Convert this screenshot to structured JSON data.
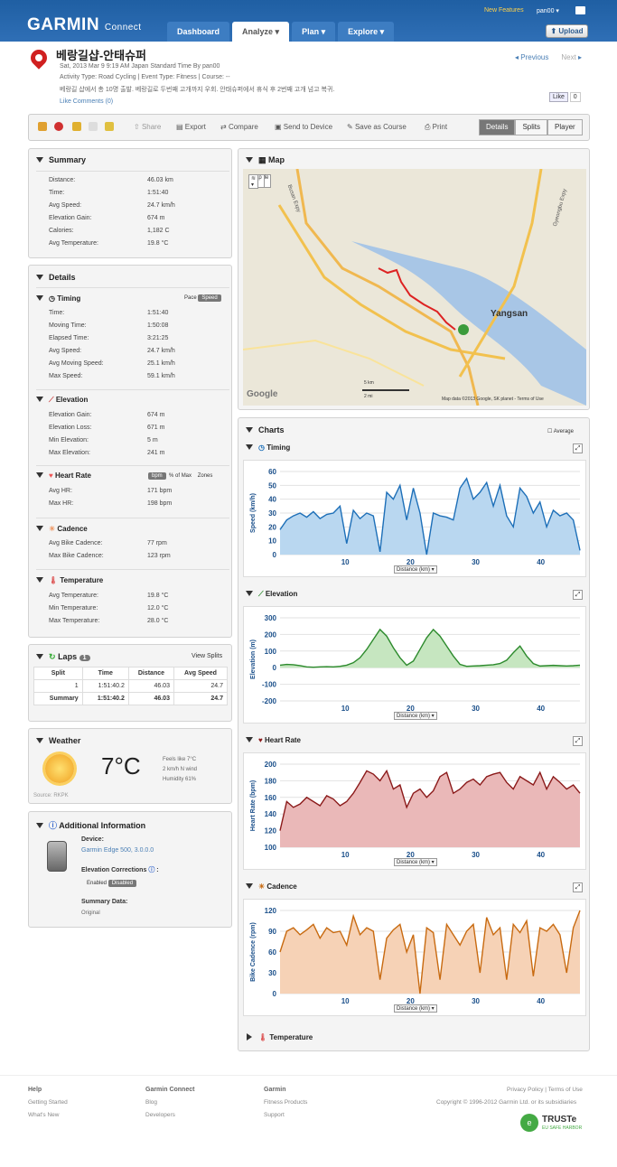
{
  "header": {
    "logo": "GARMIN",
    "logo_sub": "Connect",
    "new_features": "New Features",
    "user": "pan00 ▾",
    "upload": "Upload",
    "nav": [
      "Dashboard",
      "Analyze ▾",
      "Plan ▾",
      "Explore ▾"
    ]
  },
  "activity": {
    "title": "베랑길샵-안태슈퍼",
    "date_line": "Sat, 2013 Mar 9 9:19 AM Japan Standard Time By pan00",
    "type_line": "Activity Type: Road Cycling | Event Type: Fitness | Course: --",
    "desc": "베랑길 샵에서 총 10명 출발. 베랑길로 두번째 고개까지 우회. 안태슈퍼에서 휴식 후 2번째 고개 넘고 복귀.",
    "links": "Like   Comments (0)",
    "prev": "Previous",
    "next": "Next",
    "fb_like": "Like",
    "fb_count": "0"
  },
  "toolbar": {
    "share": "Share",
    "export": "Export",
    "compare": "Compare",
    "send": "Send to Device",
    "save": "Save as Course",
    "print": "Print",
    "tabs": [
      "Details",
      "Splits",
      "Player"
    ]
  },
  "summary": {
    "title": "Summary",
    "rows": [
      [
        "Distance:",
        "46.03 km"
      ],
      [
        "Time:",
        "1:51:40"
      ],
      [
        "Avg Speed:",
        "24.7 km/h"
      ],
      [
        "Elevation Gain:",
        "674 m"
      ],
      [
        "Calories:",
        "1,182 C"
      ],
      [
        "Avg Temperature:",
        "19.8 °C"
      ]
    ]
  },
  "details": {
    "title": "Details",
    "timing": {
      "title": "Timing",
      "pace": "Pace",
      "speed": "Speed",
      "rows": [
        [
          "Time:",
          "1:51:40"
        ],
        [
          "Moving Time:",
          "1:50:08"
        ],
        [
          "Elapsed Time:",
          "3:21:25"
        ],
        [
          "Avg Speed:",
          "24.7 km/h"
        ],
        [
          "Avg Moving Speed:",
          "25.1 km/h"
        ],
        [
          "Max Speed:",
          "59.1 km/h"
        ]
      ]
    },
    "elevation": {
      "title": "Elevation",
      "rows": [
        [
          "Elevation Gain:",
          "674 m"
        ],
        [
          "Elevation Loss:",
          "671 m"
        ],
        [
          "Min Elevation:",
          "5 m"
        ],
        [
          "Max Elevation:",
          "241 m"
        ]
      ]
    },
    "hr": {
      "title": "Heart Rate",
      "bpm": "bpm",
      "pct": "% of Max",
      "zones": "Zones",
      "rows": [
        [
          "Avg HR:",
          "171 bpm"
        ],
        [
          "Max HR:",
          "198 bpm"
        ]
      ]
    },
    "cadence": {
      "title": "Cadence",
      "rows": [
        [
          "Avg Bike Cadence:",
          "77 rpm"
        ],
        [
          "Max Bike Cadence:",
          "123 rpm"
        ]
      ]
    },
    "temp": {
      "title": "Temperature",
      "rows": [
        [
          "Avg Temperature:",
          "19.8 °C"
        ],
        [
          "Min Temperature:",
          "12.0 °C"
        ],
        [
          "Max Temperature:",
          "28.0 °C"
        ]
      ]
    }
  },
  "laps": {
    "title": "Laps",
    "count": "1",
    "view": "View Splits",
    "cols": [
      "Split",
      "Time",
      "Distance",
      "Avg Speed"
    ],
    "rows": [
      [
        "1",
        "1:51:40.2",
        "46.03",
        "24.7"
      ],
      [
        "Summary",
        "1:51:40.2",
        "46.03",
        "24.7"
      ]
    ]
  },
  "weather": {
    "title": "Weather",
    "temp": "7°C",
    "feels": "Feels like 7°C",
    "wind": "2 km/h N wind",
    "humidity": "Humidity 61%",
    "source": "Source: RKPK"
  },
  "additional": {
    "title": "Additional Information",
    "device_label": "Device:",
    "device": "Garmin Edge 500, 3.0.0.0",
    "elev_corr": "Elevation Corrections",
    "enabled": "Enabled",
    "disabled": "Disabled",
    "summary_label": "Summary Data:",
    "summary_val": "Original"
  },
  "map": {
    "title": "Map",
    "google": "Google ▾",
    "maptype": "Map ▾",
    "city": "Yangsan",
    "scale_km": "5 km",
    "scale_mi": "2 mi",
    "credit": "Map data ©2013 Google, SK planet - Terms of Use",
    "road1": "Gyeongbu Expy",
    "road2": "Busan Expy"
  },
  "charts_title": "Charts",
  "average": "Average",
  "dist_label": "Distance (km)",
  "temperature_title": "Temperature",
  "chart_data": [
    {
      "type": "area",
      "title": "Timing",
      "ylabel": "Speed (km/h)",
      "xlabel": "Distance (km)",
      "x_ticks": [
        10,
        20,
        30,
        40
      ],
      "y_ticks": [
        0,
        10,
        20,
        30,
        40,
        50,
        60
      ],
      "ylim": [
        0,
        60
      ],
      "xlim": [
        0,
        46
      ],
      "series": [
        {
          "values": [
            18,
            25,
            28,
            30,
            27,
            31,
            26,
            29,
            30,
            35,
            8,
            32,
            26,
            30,
            28,
            2,
            45,
            40,
            50,
            25,
            48,
            30,
            0,
            30,
            28,
            27,
            25,
            48,
            55,
            40,
            45,
            52,
            35,
            50,
            28,
            20,
            48,
            42,
            30,
            38,
            20,
            32,
            28,
            30,
            25,
            3
          ]
        }
      ]
    },
    {
      "type": "area",
      "title": "Elevation",
      "ylabel": "Elevation (m)",
      "xlabel": "Distance (km)",
      "x_ticks": [
        10,
        20,
        30,
        40
      ],
      "y_ticks": [
        -200,
        -100,
        0,
        100,
        200,
        300
      ],
      "ylim": [
        -200,
        300
      ],
      "xlim": [
        0,
        46
      ],
      "series": [
        {
          "values": [
            15,
            20,
            18,
            12,
            5,
            3,
            5,
            6,
            5,
            8,
            15,
            30,
            60,
            110,
            170,
            230,
            190,
            120,
            60,
            15,
            40,
            110,
            180,
            230,
            190,
            130,
            70,
            20,
            8,
            10,
            12,
            15,
            18,
            25,
            45,
            90,
            130,
            70,
            25,
            10,
            12,
            14,
            12,
            10,
            12,
            15
          ]
        }
      ]
    },
    {
      "type": "area",
      "title": "Heart Rate",
      "ylabel": "Heart Rate (bpm)",
      "xlabel": "Distance (km)",
      "x_ticks": [
        10,
        20,
        30,
        40
      ],
      "y_ticks": [
        100,
        120,
        140,
        160,
        180,
        200
      ],
      "ylim": [
        100,
        200
      ],
      "xlim": [
        0,
        46
      ],
      "series": [
        {
          "values": [
            120,
            155,
            148,
            152,
            160,
            155,
            150,
            162,
            158,
            150,
            155,
            165,
            178,
            192,
            188,
            180,
            192,
            170,
            175,
            148,
            165,
            170,
            160,
            168,
            185,
            190,
            165,
            170,
            178,
            182,
            175,
            185,
            188,
            190,
            178,
            170,
            185,
            180,
            175,
            190,
            170,
            185,
            178,
            170,
            175,
            165
          ]
        }
      ]
    },
    {
      "type": "area",
      "title": "Cadence",
      "ylabel": "Bike Cadence (rpm)",
      "xlabel": "Distance (km)",
      "x_ticks": [
        10,
        20,
        30,
        40
      ],
      "y_ticks": [
        0,
        30,
        60,
        90,
        120
      ],
      "ylim": [
        0,
        120
      ],
      "xlim": [
        0,
        46
      ],
      "series": [
        {
          "values": [
            60,
            90,
            95,
            85,
            92,
            100,
            80,
            95,
            88,
            90,
            70,
            112,
            85,
            95,
            90,
            20,
            80,
            92,
            100,
            60,
            85,
            0,
            95,
            88,
            20,
            100,
            85,
            70,
            90,
            100,
            30,
            110,
            85,
            95,
            20,
            100,
            88,
            105,
            25,
            95,
            90,
            100,
            85,
            30,
            95,
            120
          ]
        }
      ]
    }
  ],
  "footer": {
    "help": "Help",
    "help_links": [
      "Getting Started",
      "What's New"
    ],
    "gc": "Garmin Connect",
    "gc_links": [
      "Blog",
      "Developers"
    ],
    "garmin": "Garmin",
    "garmin_links": [
      "Fitness Products",
      "Support"
    ],
    "privacy": "Privacy Policy | Terms of Use",
    "copyright": "Copyright © 1996-2012 Garmin Ltd. or its subsidiaries",
    "truste": "TRUSTe",
    "truste_sub": "EU SAFE HARBOR"
  }
}
